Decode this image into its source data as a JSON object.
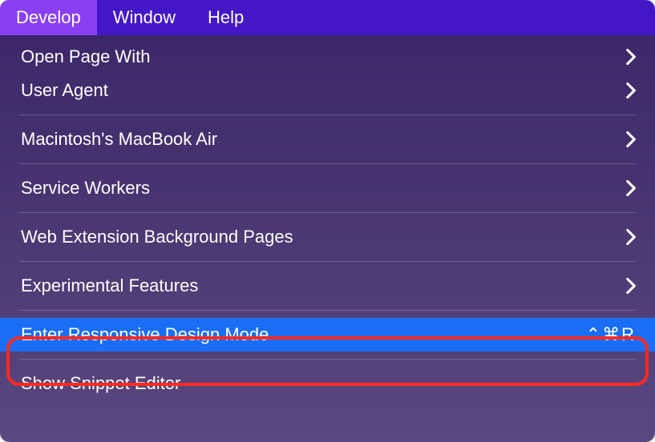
{
  "menubar": {
    "items": [
      {
        "label": "Develop",
        "active": true
      },
      {
        "label": "Window",
        "active": false
      },
      {
        "label": "Help",
        "active": false
      }
    ]
  },
  "dropdown": {
    "groups": [
      [
        {
          "label": "Open Page With",
          "submenu": true
        },
        {
          "label": "User Agent",
          "submenu": true
        }
      ],
      [
        {
          "label": "Macintosh's MacBook Air",
          "submenu": true
        }
      ],
      [
        {
          "label": "Service Workers",
          "submenu": true
        }
      ],
      [
        {
          "label": "Web Extension Background Pages",
          "submenu": true
        }
      ],
      [
        {
          "label": "Experimental Features",
          "submenu": true
        }
      ],
      [
        {
          "label": "Enter Responsive Design Mode",
          "submenu": false,
          "shortcut": "⌃⌘R",
          "highlighted": true
        }
      ],
      [
        {
          "label": "Show Snippet Editor",
          "submenu": false
        }
      ]
    ]
  }
}
